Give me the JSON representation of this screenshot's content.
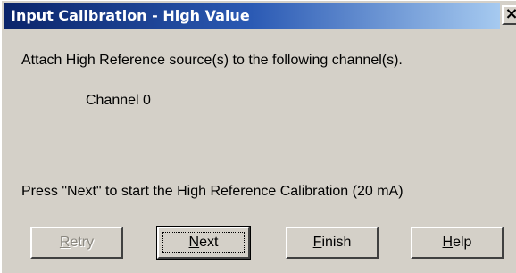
{
  "window": {
    "title": "Input Calibration - High Value",
    "close_glyph": "×"
  },
  "content": {
    "instruction": "Attach High Reference source(s) to the following channel(s).",
    "channel": "Channel 0",
    "prompt": "Press \"Next\" to start the High Reference Calibration (20 mA)"
  },
  "buttons": {
    "retry": {
      "first": "R",
      "rest": "etry",
      "enabled": false
    },
    "next": {
      "first": "N",
      "rest": "ext",
      "default": true
    },
    "finish": {
      "first": "F",
      "rest": "inish"
    },
    "help": {
      "first": "H",
      "rest": "elp"
    }
  },
  "colors": {
    "dialog_bg": "#d4d0c8",
    "titlebar_start": "#0a246a",
    "titlebar_end": "#a6caf0",
    "disabled_text": "#8a877f"
  },
  "icons": {
    "close": "close-icon"
  }
}
